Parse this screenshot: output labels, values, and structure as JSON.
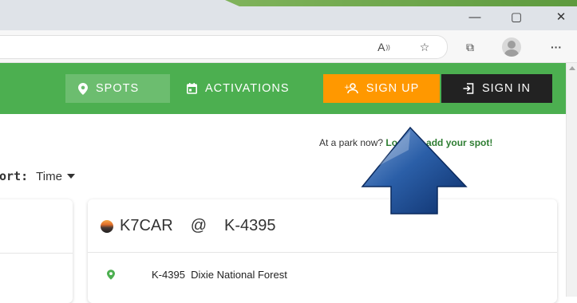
{
  "browser": {
    "window_controls": {
      "minimize": "—",
      "maximize": "▢",
      "close": "✕"
    },
    "toolbar_icons": {
      "read_aloud": "A",
      "favorites": "☆",
      "collections": "⧉",
      "more": "···"
    }
  },
  "header": {
    "nav": {
      "spots_label": "SPOTS",
      "activations_label": "ACTIVATIONS",
      "signup_label": "SIGN UP",
      "signin_label": "SIGN IN"
    },
    "colors": {
      "header_bg": "#4caf50",
      "signup_bg": "#ff9800",
      "signin_bg": "#222222"
    }
  },
  "hint": {
    "text": "At a park now? ",
    "link_text": "Login to add your spot!"
  },
  "sort": {
    "label": "Sort:",
    "value": "Time"
  },
  "spot_card": {
    "callsign": "K7CAR",
    "at": "@",
    "park_ref": "K-4395",
    "park_line": "K-4395  Dixie National Forest"
  },
  "overlay": {
    "arrow_icon": "up-arrow"
  }
}
